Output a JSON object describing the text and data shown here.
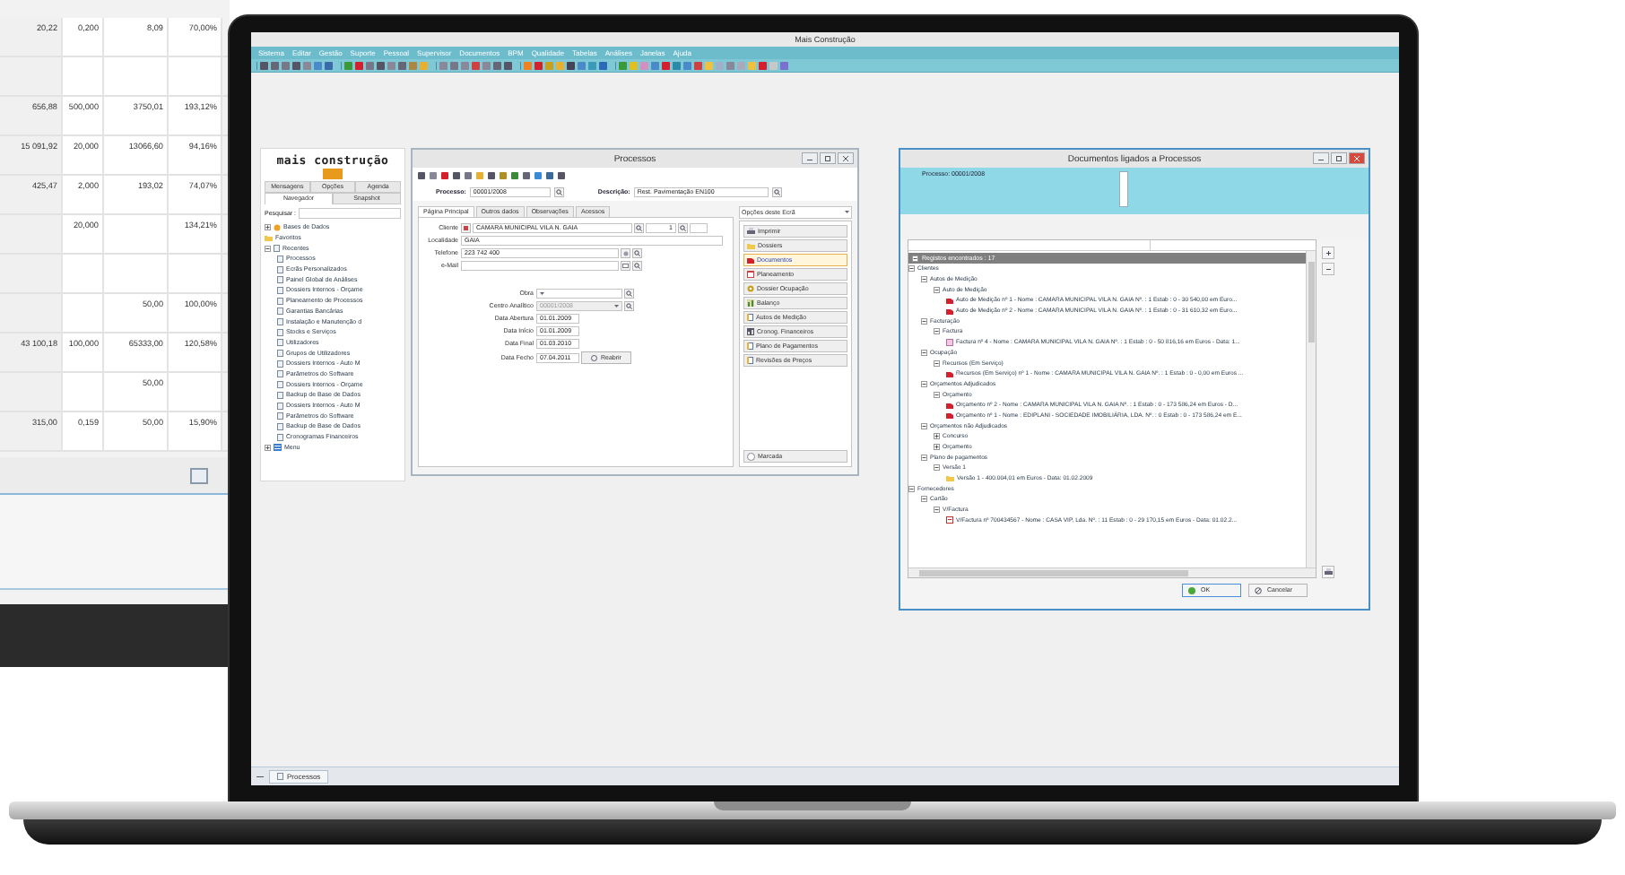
{
  "background_table": {
    "rows": [
      {
        "column_1": "20,22",
        "column_2": "0,200",
        "column_3": "8,09",
        "column_4": "70,00%"
      },
      {},
      {
        "column_1": "656,88",
        "column_2": "500,000",
        "column_3": "3750,01",
        "column_4": "193,12%"
      },
      {
        "column_1": "15 091,92",
        "column_2": "20,000",
        "column_3": "13066,60",
        "column_4": "94,16%"
      },
      {
        "column_1": "425,47",
        "column_2": "2,000",
        "column_3": "193,02",
        "column_4": "74,07%"
      },
      {
        "column_2": "20,000",
        "column_4": "134,21%"
      },
      {},
      {
        "column_3": "50,00",
        "column_4": "100,00%"
      },
      {
        "column_1": "43 100,18",
        "column_2": "100,000",
        "column_3": "65333,00",
        "column_4": "120,58%"
      },
      {
        "column_3": "50,00"
      },
      {
        "column_1": "315,00",
        "column_2": "0,159",
        "column_3": "50,00",
        "column_4": "15,90%"
      }
    ]
  },
  "app": {
    "title": "Mais Construção",
    "menu": [
      "Sistema",
      "Editar",
      "Gestão",
      "Suporte",
      "Pessoal",
      "Supervisor",
      "Documentos",
      "BPM",
      "Qualidade",
      "Tabelas",
      "Análises",
      "Janelas",
      "Ajuda"
    ],
    "logo": "mais construção",
    "navigator": {
      "tab_rows": [
        [
          {
            "label": "Mensagens",
            "selected": false
          },
          {
            "label": "Opções",
            "selected": false
          },
          {
            "label": "Agenda",
            "selected": false
          }
        ],
        [
          {
            "label": "Navegador",
            "selected": true
          },
          {
            "label": "Snapshot",
            "selected": false
          }
        ]
      ],
      "search_label": "Pesquisar :",
      "tree": [
        {
          "label": "Bases de Dados",
          "kind": "database",
          "expanded": false
        },
        {
          "label": "Favoritos",
          "kind": "folder"
        },
        {
          "label": "Recentes",
          "kind": "page",
          "expanded": true,
          "children": [
            {
              "label": "Processos",
              "kind": "page"
            },
            {
              "label": "Ecrãs Personalizados",
              "kind": "page"
            },
            {
              "label": "Painel Global de Análises",
              "kind": "page"
            },
            {
              "label": "Dossiers Internos - Orçame",
              "kind": "page"
            },
            {
              "label": "Planeamento de Processos",
              "kind": "page"
            },
            {
              "label": "Garantias Bancárias",
              "kind": "page"
            },
            {
              "label": "Instalação e Manutenção d",
              "kind": "page"
            },
            {
              "label": "Stocks e Serviços",
              "kind": "page"
            },
            {
              "label": "Utilizadores",
              "kind": "page"
            },
            {
              "label": "Grupos de Utilizadores",
              "kind": "page"
            },
            {
              "label": "Dossiers Internos - Auto M",
              "kind": "page"
            },
            {
              "label": "Parâmetros do Software",
              "kind": "page"
            },
            {
              "label": "Dossiers Internos - Orçame",
              "kind": "page"
            },
            {
              "label": "Backup de Base de Dados",
              "kind": "page"
            },
            {
              "label": "Dossiers Internos - Auto M",
              "kind": "page"
            },
            {
              "label": "Parâmetros do Software",
              "kind": "page"
            },
            {
              "label": "Backup de Base de Dados",
              "kind": "page"
            },
            {
              "label": "Cronogramas Financeiros",
              "kind": "page"
            }
          ]
        },
        {
          "label": "Menu",
          "kind": "menu",
          "expanded": false
        }
      ]
    },
    "processos": {
      "title": "Processos",
      "processo": {
        "label": "Processo:",
        "value": "00001/2008"
      },
      "descricao": {
        "label": "Descrição:",
        "value": "Rest. Pavimentação EN100"
      },
      "tabs": [
        {
          "label": "Página Principal",
          "selected": true
        },
        {
          "label": "Outros dados",
          "selected": false
        },
        {
          "label": "Observações",
          "selected": false
        },
        {
          "label": "Acessos",
          "selected": false
        }
      ],
      "fields": [
        {
          "label": "Cliente",
          "kind": "client",
          "value": "CAMARA MUNICIPAL VILA N. GAIA",
          "number": "1"
        },
        {
          "label": "Localidade",
          "kind": "plain",
          "value": "GAIA"
        },
        {
          "label": "Telefone",
          "kind": "phone",
          "value": "223 742 400"
        },
        {
          "label": "e-Mail",
          "kind": "email"
        }
      ],
      "dates": [
        {
          "label": "Obra",
          "kind": "select",
          "disabled": false
        },
        {
          "label": "Centro Analítico",
          "kind": "select",
          "value": "00001/2008",
          "disabled": true
        },
        {
          "label": "Data Abertura",
          "kind": "date",
          "value": "01.01.2009"
        },
        {
          "label": "Data Início",
          "kind": "date",
          "value": "01.01.2009"
        },
        {
          "label": "Data Final",
          "kind": "date",
          "value": "01.03.2010"
        },
        {
          "label": "Data Fecho",
          "kind": "closing",
          "value": "07.04.2011",
          "button": "Reabrir"
        }
      ],
      "options_label": "Opções deste Ecrã",
      "options": [
        {
          "label": "Imprimir",
          "kind": "printer",
          "selected": false
        },
        {
          "label": "Dossiers",
          "kind": "folder",
          "selected": false
        },
        {
          "label": "Documentos",
          "kind": "document",
          "selected": true
        },
        {
          "label": "Planeamento",
          "kind": "calendar",
          "selected": false
        },
        {
          "label": "Dossier Ocupação",
          "kind": "gear",
          "selected": false
        },
        {
          "label": "Balanço",
          "kind": "scale",
          "selected": false
        },
        {
          "label": "Autos de Medição",
          "kind": "sheet",
          "selected": false
        },
        {
          "label": "Cronog. Financeiros",
          "kind": "chart",
          "selected": false
        },
        {
          "label": "Plano de Pagamentos",
          "kind": "sheet",
          "selected": false
        },
        {
          "label": "Revisões de Preços",
          "kind": "sheet",
          "selected": false
        }
      ],
      "marked": {
        "label": "Marcada",
        "checked": false
      }
    },
    "documentos": {
      "title": "Documentos ligados a Processos",
      "processo": "Processo: 00001/2008",
      "found": "Registos encontrados : 17",
      "tree": [
        {
          "label": "Clientes",
          "expanded": true,
          "children": [
            {
              "label": "Autos de Medição",
              "expanded": true,
              "children": [
                {
                  "label": "Auto de Medição",
                  "expanded": true,
                  "children": [
                    {
                      "label": "Auto de Medição nº 1 - Nome : CAMARA MUNICIPAL VILA N. GAIA Nº. : 1 Estab : 0 - 30 540,00 em Euro...",
                      "kind": "document"
                    },
                    {
                      "label": "Auto de Medição nº 2 - Nome : CAMARA MUNICIPAL VILA N. GAIA Nº. : 1 Estab : 0 - 31 610,32 em Euro...",
                      "kind": "document"
                    }
                  ]
                }
              ]
            },
            {
              "label": "Facturação",
              "expanded": true,
              "children": [
                {
                  "label": "Factura",
                  "expanded": true,
                  "children": [
                    {
                      "label": "Factura nº 4 - Nome : CAMARA MUNICIPAL VILA N. GAIA Nº. : 1 Estab : 0 - 50 816,16 em Euros - Data: 1...",
                      "kind": "invoice"
                    }
                  ]
                }
              ]
            },
            {
              "label": "Ocupação",
              "expanded": true,
              "children": [
                {
                  "label": "Recursos (Em Serviço)",
                  "expanded": true,
                  "children": [
                    {
                      "label": "Recursos (Em Serviço) nº 1 - Nome : CAMARA MUNICIPAL VILA N. GAIA Nº. : 1 Estab : 0 - 0,00 em Euros ...",
                      "kind": "document"
                    }
                  ]
                }
              ]
            },
            {
              "label": "Orçamentos Adjudicados",
              "expanded": true,
              "children": [
                {
                  "label": "Orçamento",
                  "expanded": true,
                  "children": [
                    {
                      "label": "Orçamento nº 2 - Nome : CAMARA MUNICIPAL VILA N. GAIA Nº. : 1 Estab : 0 - 173 586,24 em Euros - D...",
                      "kind": "document"
                    },
                    {
                      "label": "Orçamento nº 1 - Nome : EDIPLANI - SOCIEDADE IMOBILIÁRIA, LDA. Nº. : 0 Estab : 0 - 173 586,24 em E...",
                      "kind": "document"
                    }
                  ]
                }
              ]
            },
            {
              "label": "Orçamentos não Adjudicados",
              "expanded": true,
              "children": [
                {
                  "label": "Concurso",
                  "expanded": false
                },
                {
                  "label": "Orçamento",
                  "expanded": false
                }
              ]
            },
            {
              "label": "Plano de pagamentos",
              "expanded": true,
              "children": [
                {
                  "label": "Versão 1",
                  "expanded": true,
                  "children": [
                    {
                      "label": "Versão 1 - 400.004,01 em Euros - Data: 01.02.2009",
                      "kind": "folder"
                    }
                  ]
                }
              ]
            }
          ]
        },
        {
          "label": "Fornecedores",
          "expanded": true,
          "children": [
            {
              "label": "Cartão",
              "expanded": true,
              "children": [
                {
                  "label": "V/Factura",
                  "expanded": true,
                  "children": [
                    {
                      "label": "V/Factura nº 700434567 - Nome : CASA VIP, Lda. Nº. : 11 Estab : 0 - 29 170,15 em Euros - Data: 01.02.2...",
                      "kind": "bill"
                    }
                  ]
                }
              ]
            }
          ]
        }
      ],
      "buttons": [
        {
          "label": "OK",
          "kind": "ok"
        },
        {
          "label": "Cancelar",
          "kind": "cancel"
        }
      ]
    },
    "taskbar": [
      {
        "label": "Processos"
      }
    ]
  }
}
